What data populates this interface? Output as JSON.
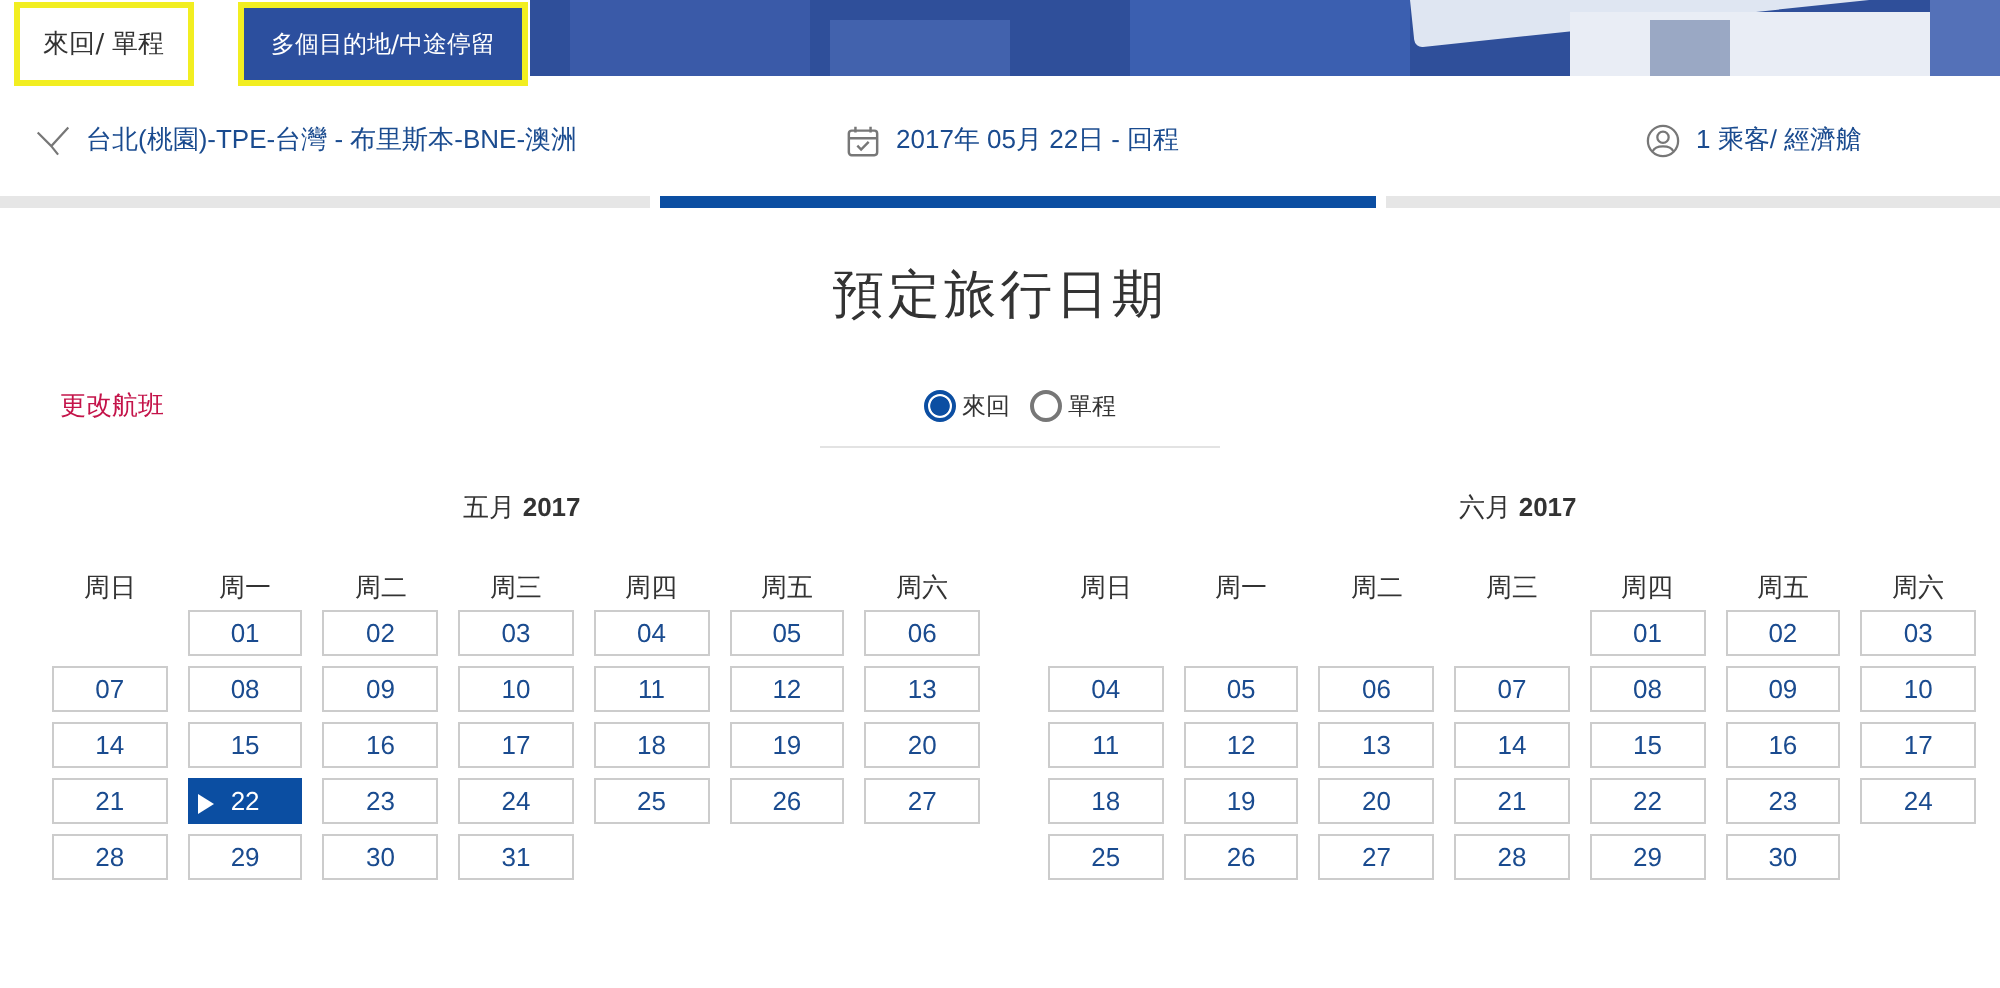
{
  "trip_tabs": [
    {
      "label": "來回/ 單程",
      "selected": true
    },
    {
      "label": "多個目的地/中途停留",
      "selected": false
    }
  ],
  "summary": {
    "route": "台北(桃園)-TPE-台灣 - 布里斯本-BNE-澳洲",
    "date": "2017年 05月 22日 -  回程",
    "passengers": "1 乘客/ 經濟艙"
  },
  "steps": [
    {
      "selected": false
    },
    {
      "selected": true
    },
    {
      "selected": false
    }
  ],
  "heading": "預定旅行日期",
  "change_flight_link": "更改航班",
  "trip_type": [
    {
      "label": "來回",
      "selected": true
    },
    {
      "label": "單程",
      "selected": false
    }
  ],
  "months": [
    {
      "title": "五月 **2017**",
      "weekdays": [
        "周日",
        "周一",
        "周二",
        "周三",
        "周四",
        "周五",
        "周六"
      ],
      "weeks": [
        {
          "kind": "leading",
          "days": [
            {
              "label": "01",
              "selected": false
            },
            {
              "label": "02",
              "selected": false
            },
            {
              "label": "03",
              "selected": false
            },
            {
              "label": "04",
              "selected": false
            },
            {
              "label": "05",
              "selected": false
            },
            {
              "label": "06",
              "selected": false
            }
          ]
        },
        {
          "kind": "full",
          "days": [
            {
              "label": "07",
              "selected": false
            },
            {
              "label": "08",
              "selected": false
            },
            {
              "label": "09",
              "selected": false
            },
            {
              "label": "10",
              "selected": false
            },
            {
              "label": "11",
              "selected": false
            },
            {
              "label": "12",
              "selected": false
            },
            {
              "label": "13",
              "selected": false
            }
          ]
        },
        {
          "kind": "full",
          "days": [
            {
              "label": "14",
              "selected": false
            },
            {
              "label": "15",
              "selected": false
            },
            {
              "label": "16",
              "selected": false
            },
            {
              "label": "17",
              "selected": false
            },
            {
              "label": "18",
              "selected": false
            },
            {
              "label": "19",
              "selected": false
            },
            {
              "label": "20",
              "selected": false
            }
          ]
        },
        {
          "kind": "full",
          "days": [
            {
              "label": "21",
              "selected": false
            },
            {
              "label": "22",
              "selected": true
            },
            {
              "label": "23",
              "selected": false
            },
            {
              "label": "24",
              "selected": false
            },
            {
              "label": "25",
              "selected": false
            },
            {
              "label": "26",
              "selected": false
            },
            {
              "label": "27",
              "selected": false
            }
          ]
        },
        {
          "kind": "trailing",
          "days": [
            {
              "label": "28",
              "selected": false
            },
            {
              "label": "29",
              "selected": false
            },
            {
              "label": "30",
              "selected": false
            },
            {
              "label": "31",
              "selected": false
            }
          ]
        }
      ]
    },
    {
      "title": "六月 **2017**",
      "weekdays": [
        "周日",
        "周一",
        "周二",
        "周三",
        "周四",
        "周五",
        "周六"
      ],
      "weeks": [
        {
          "kind": "leading",
          "days": [
            {
              "label": "01",
              "selected": false
            },
            {
              "label": "02",
              "selected": false
            },
            {
              "label": "03",
              "selected": false
            }
          ]
        },
        {
          "kind": "full",
          "days": [
            {
              "label": "04",
              "selected": false
            },
            {
              "label": "05",
              "selected": false
            },
            {
              "label": "06",
              "selected": false
            },
            {
              "label": "07",
              "selected": false
            },
            {
              "label": "08",
              "selected": false
            },
            {
              "label": "09",
              "selected": false
            },
            {
              "label": "10",
              "selected": false
            }
          ]
        },
        {
          "kind": "full",
          "days": [
            {
              "label": "11",
              "selected": false
            },
            {
              "label": "12",
              "selected": false
            },
            {
              "label": "13",
              "selected": false
            },
            {
              "label": "14",
              "selected": false
            },
            {
              "label": "15",
              "selected": false
            },
            {
              "label": "16",
              "selected": false
            },
            {
              "label": "17",
              "selected": false
            }
          ]
        },
        {
          "kind": "full",
          "days": [
            {
              "label": "18",
              "selected": false
            },
            {
              "label": "19",
              "selected": false
            },
            {
              "label": "20",
              "selected": false
            },
            {
              "label": "21",
              "selected": false
            },
            {
              "label": "22",
              "selected": false
            },
            {
              "label": "23",
              "selected": false
            },
            {
              "label": "24",
              "selected": false
            }
          ]
        },
        {
          "kind": "trailing",
          "days": [
            {
              "label": "25",
              "selected": false
            },
            {
              "label": "26",
              "selected": false
            },
            {
              "label": "27",
              "selected": false
            },
            {
              "label": "28",
              "selected": false
            },
            {
              "label": "29",
              "selected": false
            },
            {
              "label": "30",
              "selected": false
            }
          ]
        }
      ]
    }
  ]
}
